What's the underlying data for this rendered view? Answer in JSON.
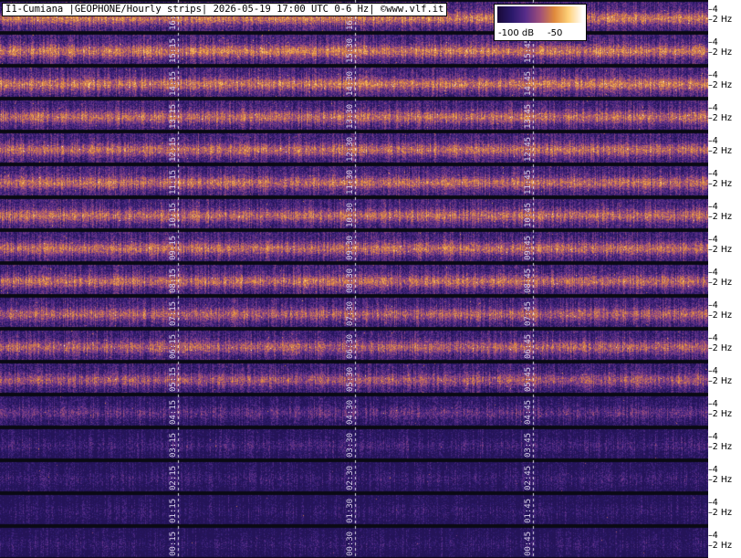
{
  "header": {
    "title": "I1-Cumiana |GEOPHONE/Hourly strips| 2026-05-19 17:00 UTC 0-6 Hz| ©www.vlf.it"
  },
  "legend": {
    "min_label": "-100 dB",
    "max_label": "-50",
    "colors": [
      "#1a0a3a",
      "#2b1a6b",
      "#5a2e8a",
      "#a0507a",
      "#e08a3c",
      "#ffd27a",
      "#ffffff"
    ]
  },
  "y_axis": {
    "tick_high": "4",
    "tick_low": "2 Hz"
  },
  "strips": [
    {
      "marks": [
        "16:15",
        "16:30",
        "16:45"
      ],
      "intensity": 0.85
    },
    {
      "marks": [
        "15:15",
        "15:30",
        "15:45"
      ],
      "intensity": 0.85
    },
    {
      "marks": [
        "14:15",
        "14:30",
        "14:45"
      ],
      "intensity": 0.85
    },
    {
      "marks": [
        "13:15",
        "13:30",
        "13:45"
      ],
      "intensity": 0.8
    },
    {
      "marks": [
        "12:15",
        "12:30",
        "12:45"
      ],
      "intensity": 0.8
    },
    {
      "marks": [
        "11:15",
        "11:30",
        "11:45"
      ],
      "intensity": 0.8
    },
    {
      "marks": [
        "10:15",
        "10:30",
        "10:45"
      ],
      "intensity": 0.8
    },
    {
      "marks": [
        "09:15",
        "09:30",
        "09:45"
      ],
      "intensity": 0.8
    },
    {
      "marks": [
        "08:15",
        "08:30",
        "08:45"
      ],
      "intensity": 0.8
    },
    {
      "marks": [
        "07:15",
        "07:30",
        "07:45"
      ],
      "intensity": 0.75
    },
    {
      "marks": [
        "06:15",
        "06:30",
        "06:45"
      ],
      "intensity": 0.75
    },
    {
      "marks": [
        "05:15",
        "05:30",
        "05:45"
      ],
      "intensity": 0.7
    },
    {
      "marks": [
        "04:15",
        "04:30",
        "04:45"
      ],
      "intensity": 0.45
    },
    {
      "marks": [
        "03:15",
        "03:30",
        "03:45"
      ],
      "intensity": 0.3
    },
    {
      "marks": [
        "02:15",
        "02:30",
        "02:45"
      ],
      "intensity": 0.25
    },
    {
      "marks": [
        "01:15",
        "01:30",
        "01:45"
      ],
      "intensity": 0.2
    },
    {
      "marks": [
        "00:15",
        "00:30",
        "00:45"
      ],
      "intensity": 0.2
    }
  ]
}
